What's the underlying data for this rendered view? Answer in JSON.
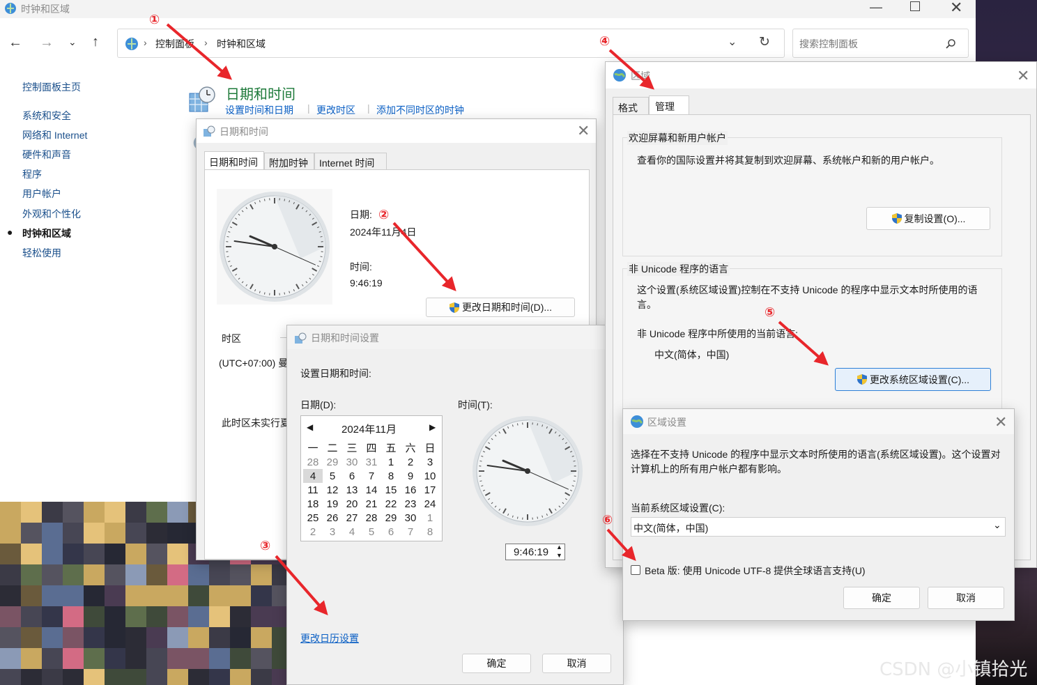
{
  "main_window": {
    "title": "时钟和区域",
    "breadcrumb": [
      "控制面板",
      "时钟和区域"
    ],
    "search_placeholder": "搜索控制面板",
    "sidebar": {
      "home": "控制面板主页",
      "items": [
        "系统和安全",
        "网络和 Internet",
        "硬件和声音",
        "程序",
        "用户帐户",
        "外观和个性化",
        "时钟和区域",
        "轻松使用"
      ],
      "active_index": 6
    },
    "section": {
      "title": "日期和时间",
      "links": [
        "设置时间和日期",
        "更改时区",
        "添加不同时区的时钟"
      ]
    }
  },
  "datetime_dialog": {
    "title": "日期和时间",
    "tabs": [
      "日期和时间",
      "附加时钟",
      "Internet 时间"
    ],
    "date_label": "日期:",
    "date_value": "2024年11月4日",
    "time_label": "时间:",
    "time_value": "9:46:19",
    "change_button": "更改日期和时间(D)...",
    "timezone_label": "时区",
    "timezone_value": "(UTC+07:00) 曼",
    "dst_note": "此时区未实行夏"
  },
  "datetime_settings_dialog": {
    "title": "日期和时间设置",
    "heading": "设置日期和时间:",
    "date_label": "日期(D):",
    "time_label": "时间(T):",
    "calendar": {
      "month": "2024年11月",
      "weekdays": [
        "一",
        "二",
        "三",
        "四",
        "五",
        "六",
        "日"
      ],
      "rows": [
        [
          "28",
          "29",
          "30",
          "31",
          "1",
          "2",
          "3"
        ],
        [
          "4",
          "5",
          "6",
          "7",
          "8",
          "9",
          "10"
        ],
        [
          "11",
          "12",
          "13",
          "14",
          "15",
          "16",
          "17"
        ],
        [
          "18",
          "19",
          "20",
          "21",
          "22",
          "23",
          "24"
        ],
        [
          "25",
          "26",
          "27",
          "28",
          "29",
          "30",
          "1"
        ],
        [
          "2",
          "3",
          "4",
          "5",
          "6",
          "7",
          "8"
        ]
      ],
      "selected": "4"
    },
    "time_value": "9:46:19",
    "calendar_link": "更改日历设置",
    "ok": "确定",
    "cancel": "取消"
  },
  "region_dialog": {
    "title": "区域",
    "tabs": [
      "格式",
      "管理"
    ],
    "welcome_group": {
      "legend": "欢迎屏幕和新用户帐户",
      "text": "查看你的国际设置并将其复制到欢迎屏幕、系统帐户和新的用户帐户。",
      "button": "复制设置(O)..."
    },
    "unicode_group": {
      "legend": "非 Unicode 程序的语言",
      "text": "这个设置(系统区域设置)控制在不支持 Unicode 的程序中显示文本时所使用的语言。",
      "current_label": "非 Unicode 程序中所使用的当前语言:",
      "current_value": "中文(简体，中国)",
      "button": "更改系统区域设置(C)..."
    }
  },
  "region_settings_dialog": {
    "title": "区域设置",
    "text": "选择在不支持 Unicode 的程序中显示文本时所使用的语言(系统区域设置)。这个设置对计算机上的所有用户帐户都有影响。",
    "current_label": "当前系统区域设置(C):",
    "current_value": "中文(简体，中国)",
    "beta_label": "Beta 版: 使用 Unicode UTF-8 提供全球语言支持(U)",
    "beta_checked": false,
    "ok": "确定",
    "cancel": "取消"
  },
  "annotations": [
    "①",
    "②",
    "③",
    "④",
    "⑤",
    "⑥"
  ],
  "watermark": "CSDN @小镇拾光",
  "colors": {
    "accent": "#0a5fc4",
    "arrow": "#e8262b",
    "section_title": "#1e7a3a"
  }
}
